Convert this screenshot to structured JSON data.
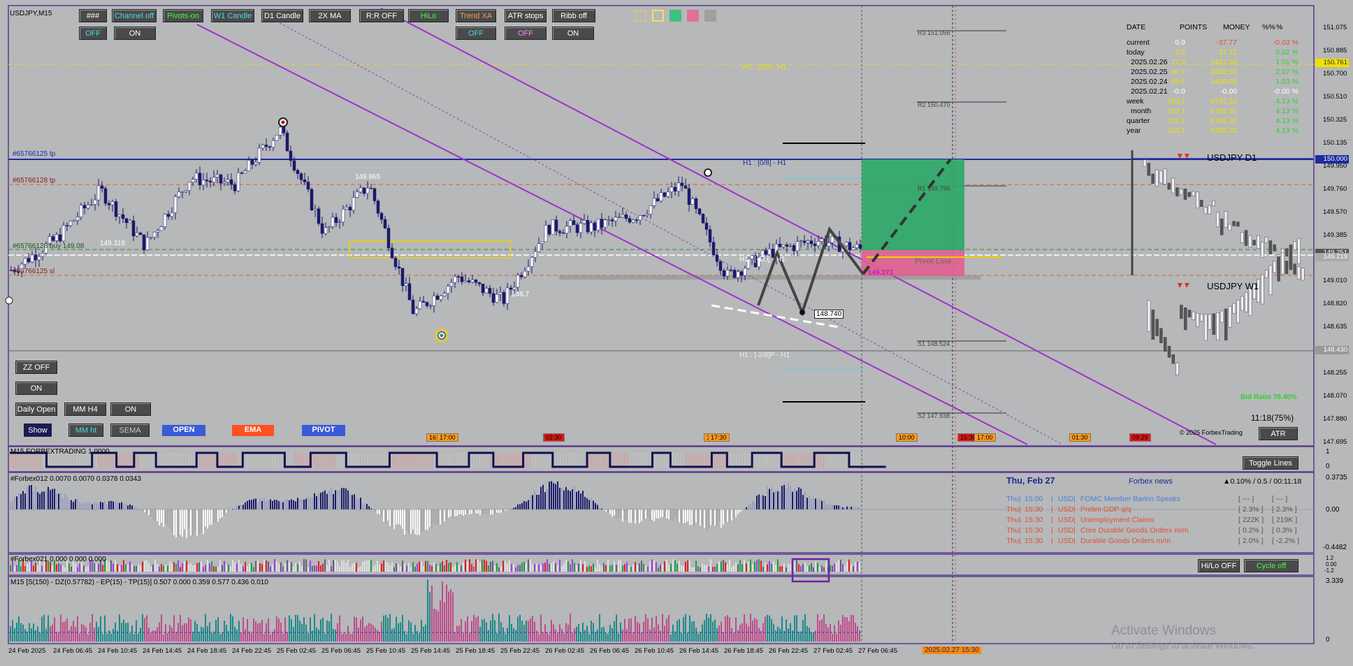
{
  "window": {
    "symbol_label": "USDJPY,M15"
  },
  "toolbar": {
    "row1": [
      {
        "label": "###",
        "color": "#ffffff",
        "bg": "#4a4a4a"
      },
      {
        "label": "Channel off",
        "color": "#4fd8e8",
        "bg": "#4a4a4a"
      },
      {
        "label": "Pivots-on",
        "color": "#40ff40",
        "bg": "#4a4a4a"
      },
      {
        "label": "W1 Candle",
        "color": "#4fd8e8",
        "bg": "#4a4a4a"
      },
      {
        "label": "D1 Candle",
        "color": "#ffffff",
        "bg": "#4a4a4a"
      },
      {
        "label": "2X MA",
        "color": "#ffffff",
        "bg": "#4a4a4a"
      },
      {
        "label": "R:R OFF",
        "color": "#ffffff",
        "bg": "#4a4a4a"
      },
      {
        "label": "HiLo",
        "color": "#40ff40",
        "bg": "#4a4a4a"
      },
      {
        "label": "Trend XA",
        "color": "#ff9955",
        "bg": "#4a4a4a"
      },
      {
        "label": "ATR stops",
        "color": "#ffffff",
        "bg": "#4a4a4a"
      },
      {
        "label": "Ribb off",
        "color": "#ffffff",
        "bg": "#4a4a4a"
      }
    ],
    "row2": [
      {
        "label": "OFF",
        "color": "#4fd8e8"
      },
      {
        "label": "ON",
        "color": "#ffffff"
      },
      {
        "label": "OFF",
        "color": "#4fd8e8"
      },
      {
        "label": "OFF",
        "color": "#ff88ff"
      },
      {
        "label": "ON",
        "color": "#ffffff"
      }
    ],
    "swatches": [
      "#d8c080",
      "#f0e060",
      "#40c080",
      "#e07098",
      "#a0a0a0"
    ]
  },
  "left_panel": {
    "zz": "ZZ OFF",
    "zz_state": "ON",
    "daily_open": "Daily Open",
    "mm_h4": "MM H4",
    "mm_state": "ON",
    "show": "Show",
    "mm_ht": "MM ht",
    "sema": "SEMA",
    "open": "OPEN",
    "ema": "EMA",
    "pivot": "PIVOT"
  },
  "order_labels": {
    "tp1": "#65766125 tp",
    "tp2": "#65766128 tp",
    "buy": "#65766128 buy 149.08",
    "sl": "#65766125 sl"
  },
  "price_tags": {
    "p1": "149.318",
    "p2": "149.865",
    "p3": "148.7",
    "p4": "148.740",
    "p5": "149.271"
  },
  "levels": {
    "r3": "R3 151.056",
    "r2": "R2 150.470",
    "r1": "R1 149.796",
    "s1": "S1 148.524",
    "s2": "S2 147.938",
    "h1a": "H1 : [1/8] - H1",
    "h1b": "H1 : [0/8] - H1",
    "h1c": "H1 : [-1/8] - H1",
    "h1d": "H1 : [-2/8]P - H1",
    "pivot_line": "Pivot Line"
  },
  "time_markers": [
    {
      "label": "16",
      "color": "#ff9a1a"
    },
    {
      "label": "17:00",
      "color": "#ff9a1a"
    },
    {
      "label": "02:30",
      "color": "#e01818"
    },
    {
      "label": "16",
      "color": "#ff9a1a"
    },
    {
      "label": "17:30",
      "color": "#ff9a1a"
    },
    {
      "label": "10:00",
      "color": "#ff9a1a"
    },
    {
      "label": "15:30",
      "color": "#e01818"
    },
    {
      "label": "17:00",
      "color": "#ff9a1a"
    },
    {
      "label": "01:30",
      "color": "#ff9a1a"
    },
    {
      "label": "09:29",
      "color": "#e01818"
    }
  ],
  "stats": {
    "headers": [
      "DATE",
      "POINTS",
      "MONEY",
      "%%",
      "%"
    ],
    "rows": [
      {
        "d": "current",
        "p": "0.9",
        "m": "-37.77",
        "pc": "-0.03 %"
      },
      {
        "d": "today",
        "p": "2.5",
        "m": "31.72",
        "pc": "0.02 %"
      },
      {
        "d": "2025.02.26",
        "p": "77.4",
        "m": "1417.96",
        "pc": "1.01 %"
      },
      {
        "d": "2025.02.25",
        "p": "60.7",
        "m": "2893.55",
        "pc": "2.07 %"
      },
      {
        "d": "2025.02.24",
        "p": "69.5",
        "m": "1439.09",
        "pc": "1.03 %"
      },
      {
        "d": "2025.02.21",
        "p": "-0.0",
        "m": "-0.00",
        "pc": "-0.00 %"
      },
      {
        "d": "week",
        "p": "210.1",
        "m": "5782.32",
        "pc": "4.13 %"
      },
      {
        "d": "month",
        "p": "210.1",
        "m": "5782.32",
        "pc": "4.13 %"
      },
      {
        "d": "quarter",
        "p": "210.1",
        "m": "5782.32",
        "pc": "4.13 %"
      },
      {
        "d": "year",
        "p": "210.1",
        "m": "5782.32",
        "pc": "4.13 %"
      }
    ]
  },
  "mini": {
    "d1": "USDJPY D1",
    "w1": "USDJPY W1",
    "bid_ratio": "Bid Ratio 78.40%",
    "timer": "11:18(75%)",
    "copyright": "© 2025 ForbexTrading",
    "atr": "ATR"
  },
  "price_axis": [
    "151.075",
    "150.885",
    "150.700",
    "150.510",
    "150.325",
    "150.135",
    "149.950",
    "149.760",
    "149.570",
    "149.385",
    "149.195",
    "149.010",
    "148.820",
    "148.635",
    "148.445",
    "148.255",
    "148.070",
    "147.880",
    "147.695"
  ],
  "axis_tags": [
    {
      "label": "150.761",
      "bg": "#f0e000",
      "color": "#333"
    },
    {
      "label": "150.000",
      "bg": "#1e2aa0",
      "color": "#fff"
    },
    {
      "label": "149.251",
      "bg": "#555",
      "color": "#fff"
    },
    {
      "label": "149.219",
      "bg": "#aaa",
      "color": "#fff"
    },
    {
      "label": "148.430",
      "bg": "#999",
      "color": "#fff"
    }
  ],
  "ind1": {
    "label": "M15 FORBEXTRADING 1.0000",
    "scale": [
      "1",
      "0"
    ],
    "button": "Toggle Lines"
  },
  "ind2": {
    "label": "#Forbex012 0.0070 0.0070 0.0378 0.0343",
    "scale": [
      "0.3735",
      "0.00",
      "-0.4482"
    ]
  },
  "news": {
    "date": "Thu, Feb 27",
    "title": "Forbex news",
    "info": "▲0.10% / 0.5 / 00:11:18",
    "items": [
      {
        "day": "Thu",
        "time": "15:00",
        "cur": "USD",
        "event": "FOMC Member Barkin Speaks",
        "a": "[ --- ]",
        "b": "[ --- ]",
        "color": "#4a80d8"
      },
      {
        "day": "Thu",
        "time": "15:30",
        "cur": "USD",
        "event": "Prelim GDP q/q",
        "a": "[ 2.3% ]",
        "b": "[ 2.3% ]",
        "color": "#e05030"
      },
      {
        "day": "Thu",
        "time": "15:30",
        "cur": "USD",
        "event": "Unemployment Claims",
        "a": "[ 222K ]",
        "b": "[ 219K ]",
        "color": "#e05030"
      },
      {
        "day": "Thu",
        "time": "15:30",
        "cur": "USD",
        "event": "Core Durable Goods Orders m/m",
        "a": "[ 0.2% ]",
        "b": "[ 0.3% ]",
        "color": "#e05030"
      },
      {
        "day": "Thu",
        "time": "15:30",
        "cur": "USD",
        "event": "Durable Goods Orders m/m",
        "a": "[ 2.0% ]",
        "b": "[ -2.2% ]",
        "color": "#e05030"
      }
    ]
  },
  "ind3": {
    "label": "#Forbex021 0.000 0.000 0.000",
    "scale": [
      "1.2",
      "0.00",
      "-1.2"
    ],
    "hilo": "Hi/Lo OFF",
    "cycle": "Cycle off"
  },
  "ind4": {
    "label": "M15 [S(150) - DZ(0.57782) - EP(15) - TP(15)] 0.507 0.000 0.359 0.577 0.436 0.010",
    "scale": [
      "3.339",
      "0"
    ]
  },
  "time_axis": [
    "24 Feb 2025",
    "24 Feb 06:45",
    "24 Feb 10:45",
    "24 Feb 14:45",
    "24 Feb 18:45",
    "24 Feb 22:45",
    "25 Feb 02:45",
    "25 Feb 06:45",
    "25 Feb 10:45",
    "25 Feb 14:45",
    "25 Feb 18:45",
    "25 Feb 22:45",
    "26 Feb 02:45",
    "26 Feb 06:45",
    "26 Feb 10:45",
    "26 Feb 14:45",
    "26 Feb 18:45",
    "26 Feb 22:45",
    "27 Feb 02:45",
    "27 Feb 06:45"
  ],
  "time_tag": "2025.02.27 15:30",
  "watermark": {
    "line1": "Activate Windows",
    "line2": "Go to Settings to activate Windows."
  },
  "chart_data": {
    "type": "candlestick",
    "symbol": "USDJPY",
    "timeframe": "M15",
    "ylim": [
      147.695,
      151.075
    ],
    "x": [
      "24 Feb 2025",
      "24 Feb 06:45",
      "24 Feb 10:45",
      "24 Feb 14:45",
      "24 Feb 18:45",
      "24 Feb 22:45",
      "25 Feb 02:45",
      "25 Feb 06:45",
      "25 Feb 10:45",
      "25 Feb 14:45",
      "25 Feb 18:45",
      "25 Feb 22:45",
      "26 Feb 02:45",
      "26 Feb 06:45",
      "26 Feb 10:45",
      "26 Feb 14:45",
      "26 Feb 18:45",
      "26 Feb 22:45",
      "27 Feb 02:45",
      "27 Feb 06:45"
    ],
    "close": [
      149.1,
      149.35,
      149.75,
      149.3,
      149.85,
      149.8,
      150.25,
      149.4,
      149.8,
      148.75,
      149.05,
      148.85,
      149.45,
      149.45,
      149.55,
      149.8,
      149.05,
      149.25,
      149.35,
      149.27
    ],
    "high": [
      149.25,
      149.55,
      149.9,
      149.9,
      149.95,
      149.95,
      150.45,
      149.95,
      149.95,
      149.35,
      149.15,
      149.2,
      149.6,
      149.6,
      149.7,
      150.0,
      149.5,
      149.4,
      149.45,
      149.35
    ],
    "low": [
      148.95,
      149.1,
      149.4,
      149.2,
      149.6,
      149.65,
      149.75,
      149.25,
      149.4,
      148.6,
      148.85,
      148.65,
      148.95,
      149.3,
      149.35,
      149.3,
      148.9,
      148.8,
      148.8,
      149.1
    ],
    "levels": {
      "R3": 151.056,
      "R2": 150.47,
      "R1": 149.796,
      "S1": 148.524,
      "S2": 147.938,
      "tp": 150.0,
      "entry": 149.08
    },
    "bid": 149.219
  }
}
